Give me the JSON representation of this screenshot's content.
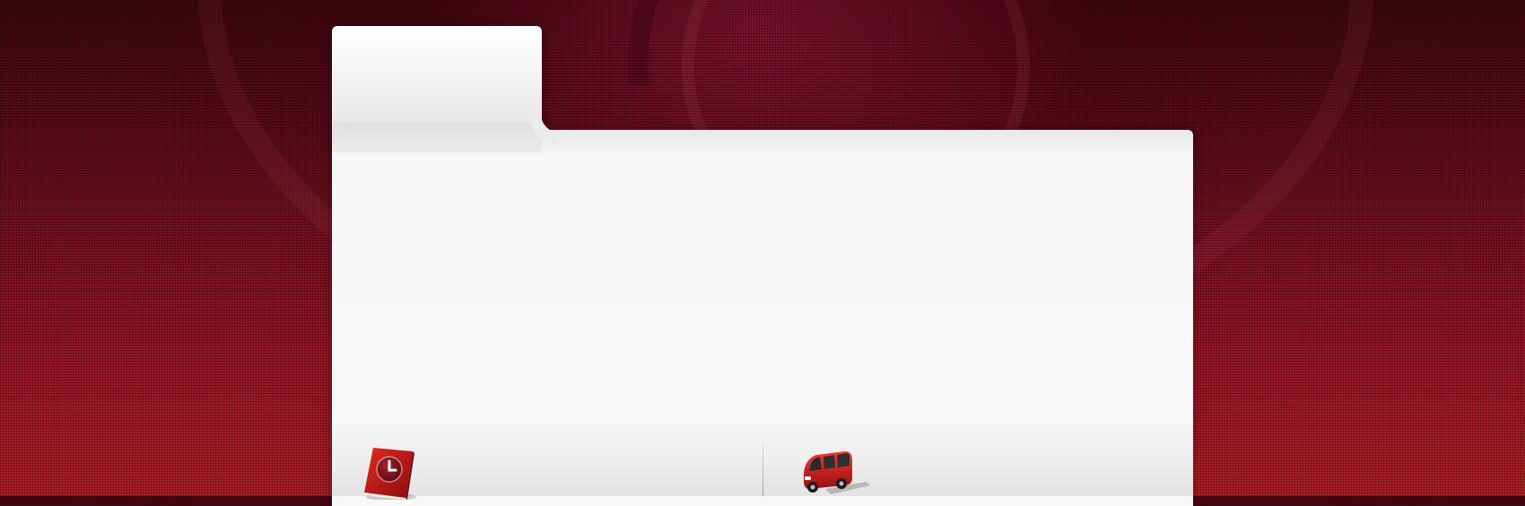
{
  "background": {
    "base_color": "#6a0f1f",
    "glow_color": "#b01f24"
  },
  "panel": {
    "color": "#f8f8f8"
  },
  "icons": {
    "left": "book-clock-icon",
    "right": "van-icon"
  }
}
